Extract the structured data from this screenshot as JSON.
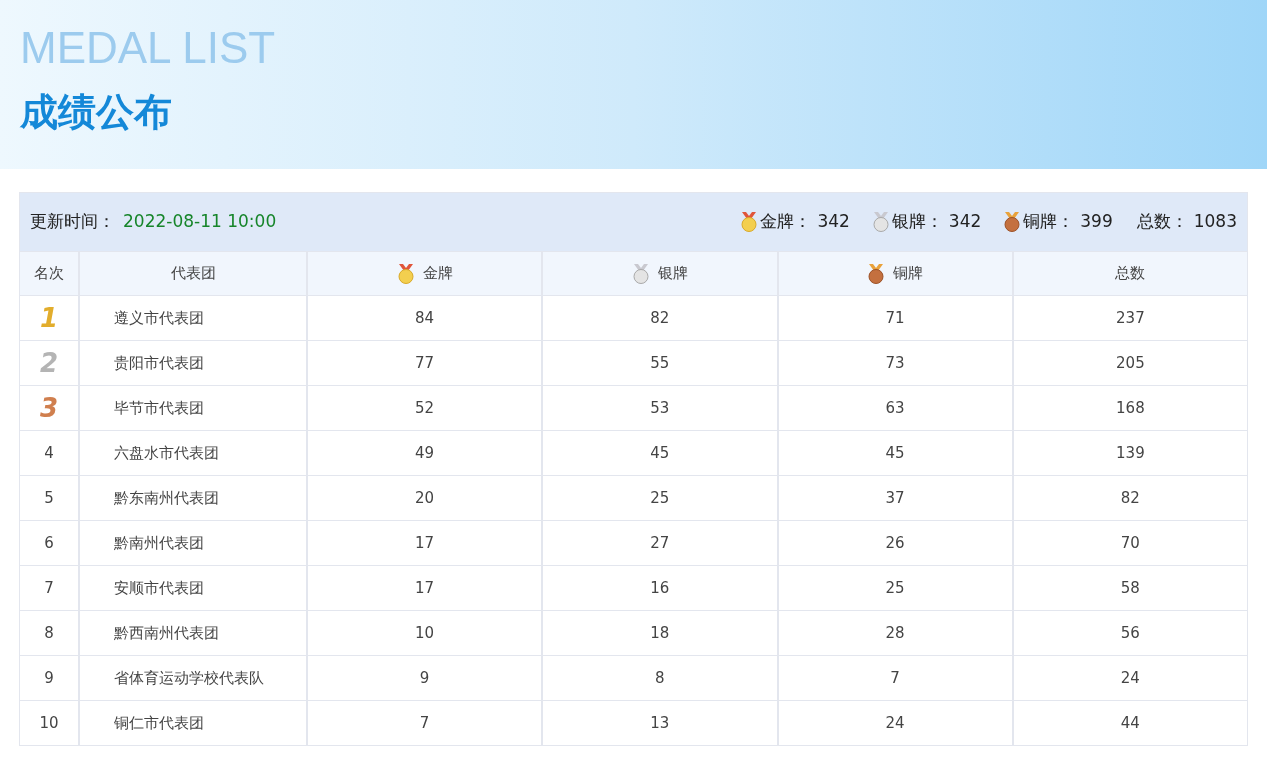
{
  "banner": {
    "title_en": "MEDAL LIST",
    "title": "成绩公布"
  },
  "summary": {
    "updated_label": "更新时间：",
    "updated_value": "2022-08-11 10:00",
    "items": [
      {
        "kind": "gold",
        "label": "金牌：",
        "value": "342"
      },
      {
        "kind": "silver",
        "label": "银牌：",
        "value": "342"
      },
      {
        "kind": "bronze",
        "label": "铜牌：",
        "value": "399"
      },
      {
        "kind": "plain",
        "label": "总数：",
        "value": "1083"
      }
    ]
  },
  "table": {
    "columns": [
      {
        "label": "名次",
        "kind": "plain"
      },
      {
        "label": "代表团",
        "kind": "plain"
      },
      {
        "label": "金牌",
        "kind": "gold"
      },
      {
        "label": "银牌",
        "kind": "silver"
      },
      {
        "label": "铜牌",
        "kind": "bronze"
      },
      {
        "label": "总数",
        "kind": "plain"
      }
    ],
    "rows": [
      {
        "rank": "1",
        "kind": "gold",
        "team": "遵义市代表团",
        "gold": "84",
        "silver": "82",
        "bronze": "71",
        "total": "237"
      },
      {
        "rank": "2",
        "kind": "silver",
        "team": "贵阳市代表团",
        "gold": "77",
        "silver": "55",
        "bronze": "73",
        "total": "205"
      },
      {
        "rank": "3",
        "kind": "bronze",
        "team": "毕节市代表团",
        "gold": "52",
        "silver": "53",
        "bronze": "63",
        "total": "168"
      },
      {
        "rank": "4",
        "kind": "plain",
        "team": "六盘水市代表团",
        "gold": "49",
        "silver": "45",
        "bronze": "45",
        "total": "139"
      },
      {
        "rank": "5",
        "kind": "plain",
        "team": "黔东南州代表团",
        "gold": "20",
        "silver": "25",
        "bronze": "37",
        "total": "82"
      },
      {
        "rank": "6",
        "kind": "plain",
        "team": "黔南州代表团",
        "gold": "17",
        "silver": "27",
        "bronze": "26",
        "total": "70"
      },
      {
        "rank": "7",
        "kind": "plain",
        "team": "安顺市代表团",
        "gold": "17",
        "silver": "16",
        "bronze": "25",
        "total": "58"
      },
      {
        "rank": "8",
        "kind": "plain",
        "team": "黔西南州代表团",
        "gold": "10",
        "silver": "18",
        "bronze": "28",
        "total": "56"
      },
      {
        "rank": "9",
        "kind": "plain",
        "team": "省体育运动学校代表队",
        "gold": "9",
        "silver": "8",
        "bronze": "7",
        "total": "24"
      },
      {
        "rank": "10",
        "kind": "plain",
        "team": "铜仁市代表团",
        "gold": "7",
        "silver": "13",
        "bronze": "24",
        "total": "44"
      }
    ]
  }
}
